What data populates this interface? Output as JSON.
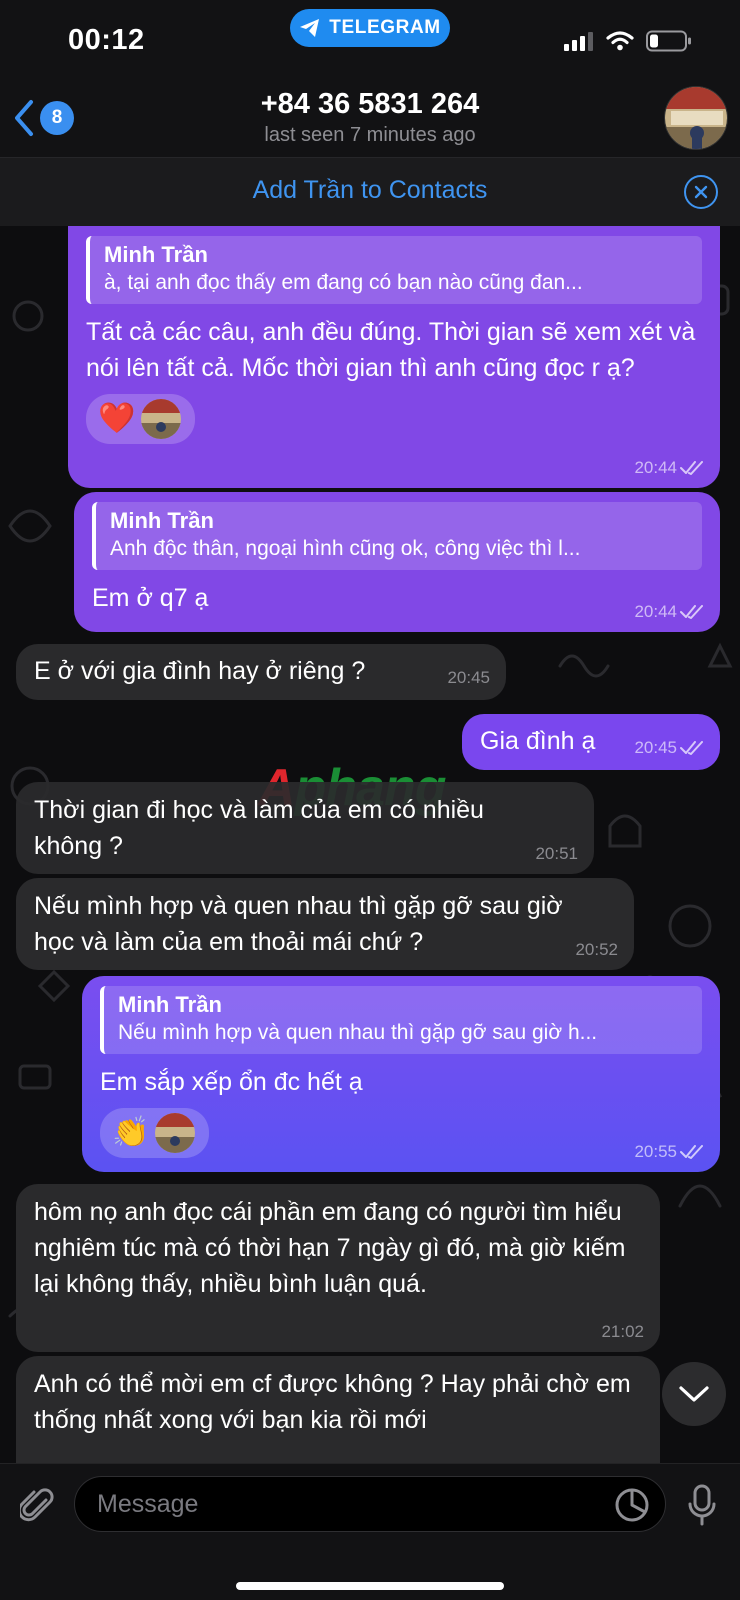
{
  "status_bar": {
    "time": "00:12",
    "app_pill": "TELEGRAM",
    "icons": [
      "signal-icon",
      "wifi-icon",
      "battery-icon"
    ]
  },
  "header": {
    "unread_count": "8",
    "title": "+84 36 5831 264",
    "subtitle": "last seen 7 minutes ago"
  },
  "banner": {
    "label": "Add Trần to Contacts"
  },
  "watermark": {
    "first": "A",
    "rest": "phang"
  },
  "messages": [
    {
      "dir": "out",
      "reply_name": "Minh Trần",
      "reply_text": "à, tại anh đọc thấy em đang có bạn nào cũng đan...",
      "text": "Tất cả các câu, anh đều đúng. Thời gian sẽ xem xét và nói lên tất cả. Mốc thời gian thì anh cũng đọc r ạ?",
      "reaction": "❤️",
      "time": "20:44"
    },
    {
      "dir": "out",
      "reply_name": "Minh Trần",
      "reply_text": "Anh độc thân, ngoại hình cũng ok, công việc thì l...",
      "text": "Em ở q7 ạ",
      "time": "20:44"
    },
    {
      "dir": "in",
      "text": "E ở với gia đình hay ở riêng ?",
      "time": "20:45"
    },
    {
      "dir": "out",
      "text": "Gia đình ạ",
      "time": "20:45"
    },
    {
      "dir": "in",
      "text": "Thời gian đi học và làm của em có nhiều không ?",
      "time": "20:51"
    },
    {
      "dir": "in",
      "text": "Nếu mình hợp và quen nhau thì gặp gỡ sau giờ học và làm của em thoải mái chứ ?",
      "time": "20:52"
    },
    {
      "dir": "out",
      "reply_name": "Minh Trần",
      "reply_text": "Nếu mình hợp và quen nhau thì gặp gỡ sau giờ h...",
      "text": "Em sắp xếp ổn đc hết ạ",
      "reaction": "👏",
      "time": "20:55"
    },
    {
      "dir": "in",
      "text": "hôm nọ anh đọc cái phần em đang có người tìm hiểu nghiêm túc mà có thời hạn 7 ngày gì đó, mà giờ kiếm lại không thấy, nhiều bình luận quá.",
      "time": "21:02"
    },
    {
      "dir": "in",
      "text": "Anh có thể mời em cf được không ? Hay phải chờ em thống nhất xong với bạn kia rồi mới"
    }
  ],
  "input": {
    "placeholder": "Message"
  }
}
